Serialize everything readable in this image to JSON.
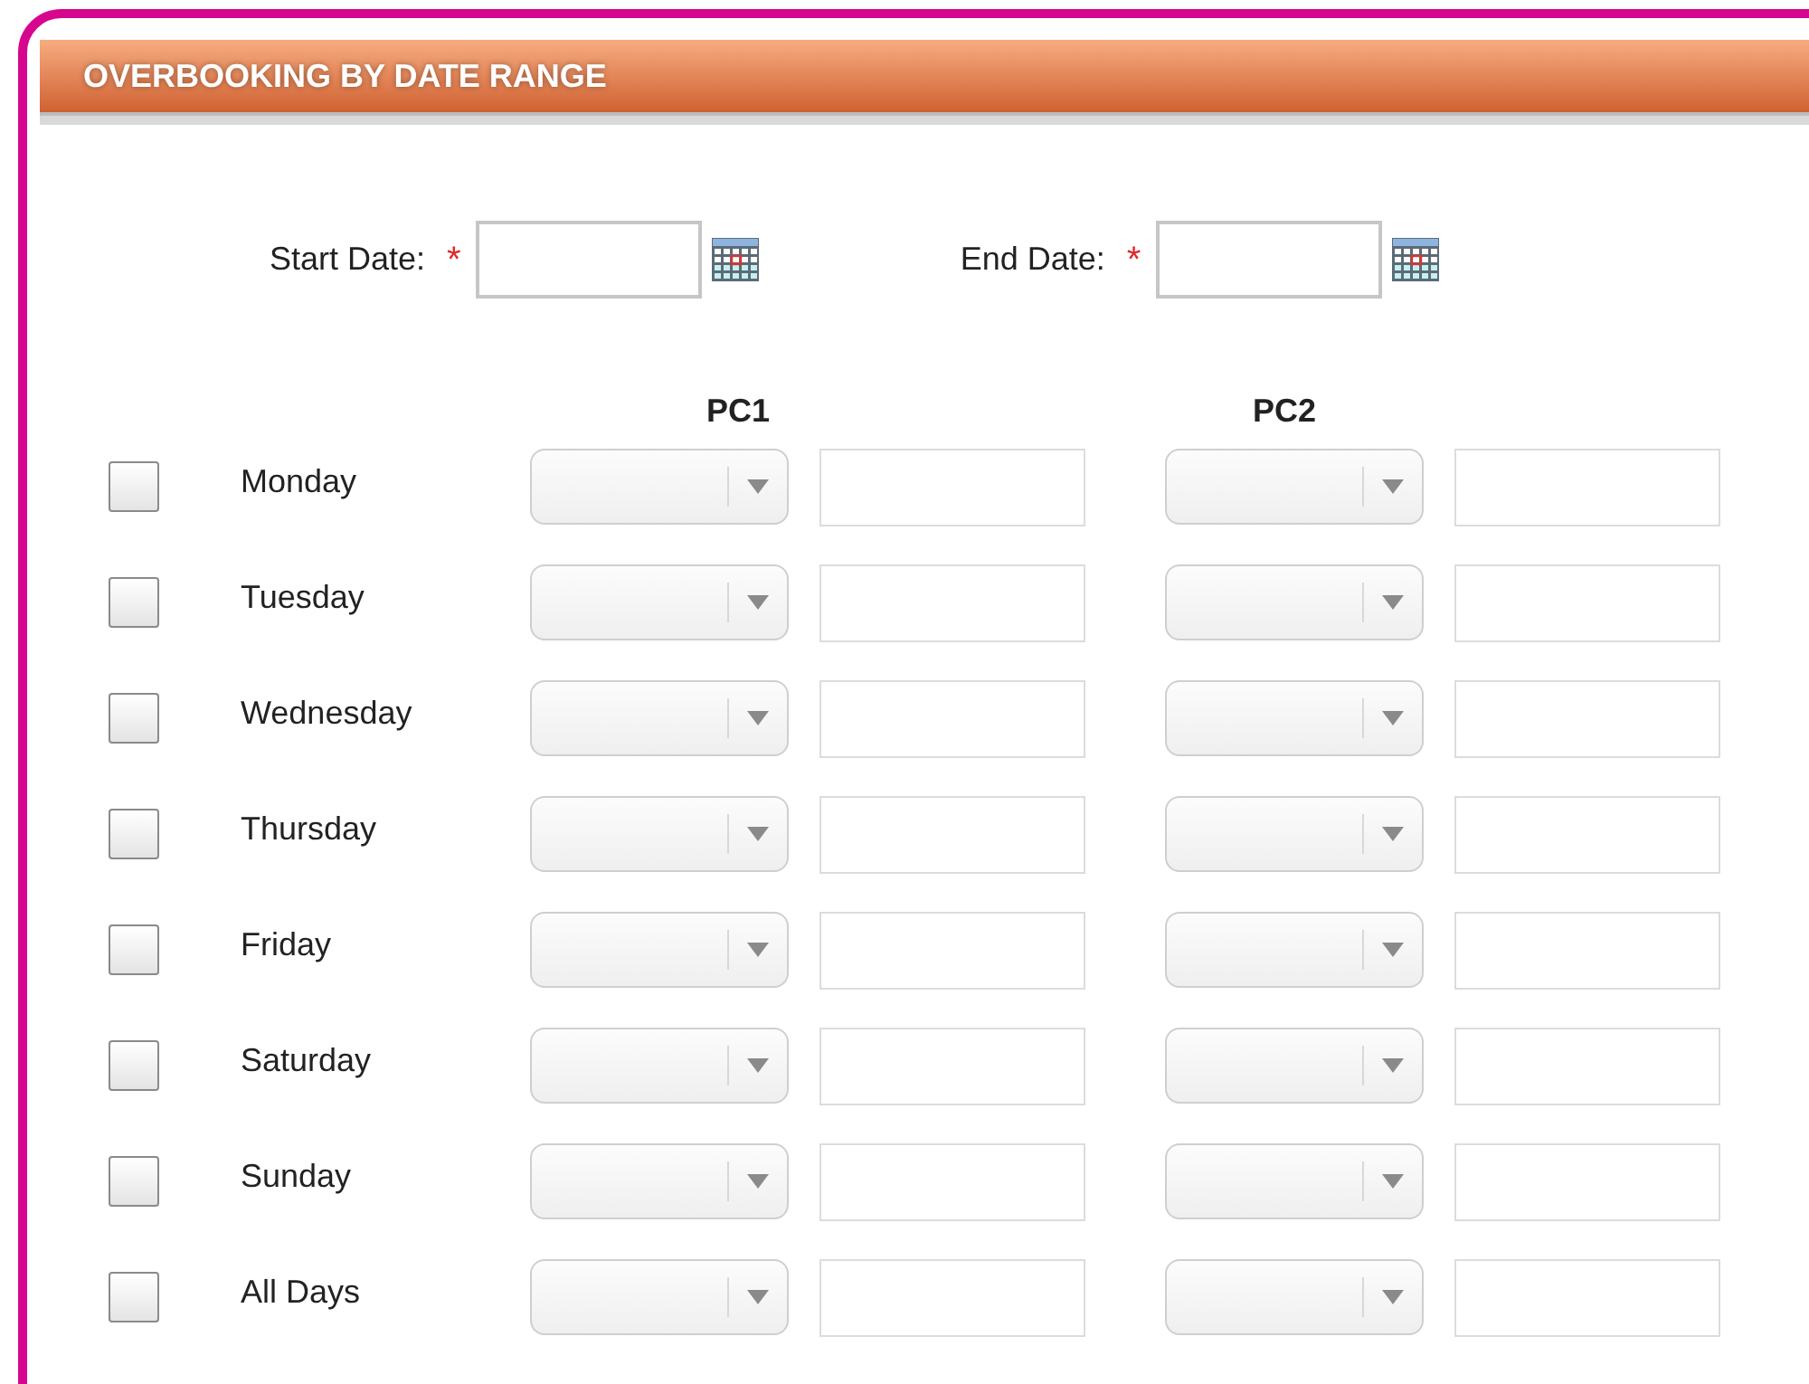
{
  "header": {
    "title": "OVERBOOKING BY DATE RANGE"
  },
  "date_fields": [
    {
      "label": "Start Date:",
      "required_mark": "*"
    },
    {
      "label": "End Date:",
      "required_mark": "*"
    }
  ],
  "columns": [
    "PC1",
    "PC2"
  ],
  "days": [
    {
      "label": "Monday",
      "checked": false
    },
    {
      "label": "Tuesday",
      "checked": false
    },
    {
      "label": "Wednesday",
      "checked": false
    },
    {
      "label": "Thursday",
      "checked": false
    },
    {
      "label": "Friday",
      "checked": false
    },
    {
      "label": "Saturday",
      "checked": false
    },
    {
      "label": "Sunday",
      "checked": false
    },
    {
      "label": "All Days",
      "checked": false
    }
  ]
}
